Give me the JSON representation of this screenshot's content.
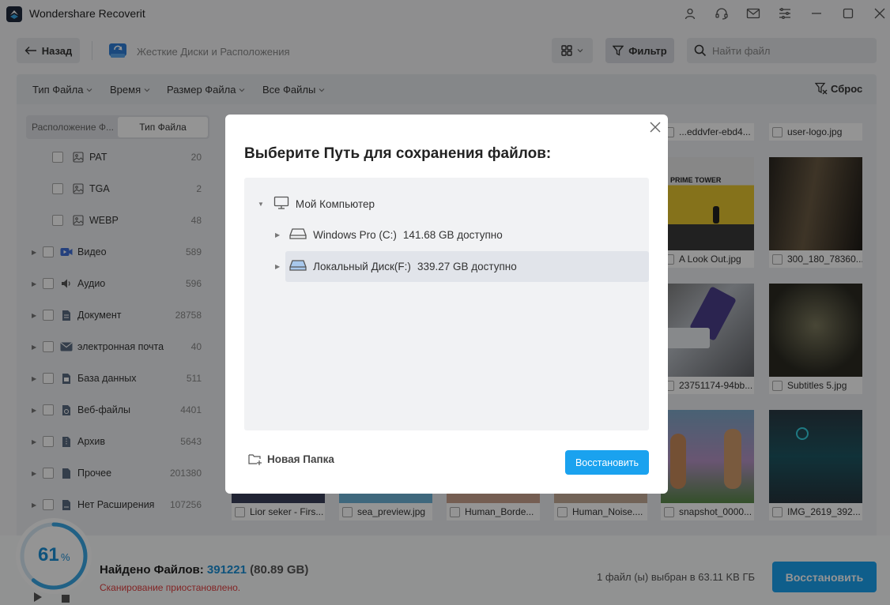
{
  "app": {
    "title": "Wondershare Recoverit"
  },
  "toolbar": {
    "back_label": "Назад",
    "location_label": "Жесткие Диски и Расположения",
    "filter_label": "Фильтр",
    "search_placeholder": "Найти файл"
  },
  "filters": {
    "file_type": "Тип Файла",
    "time": "Время",
    "file_size": "Размер Файла",
    "all_files": "Все Файлы",
    "reset": "Сброс"
  },
  "sidebar": {
    "tab_location": "Расположение Ф...",
    "tab_type": "Тип Файла",
    "sub_items": [
      {
        "label": "PAT",
        "count": "20"
      },
      {
        "label": "TGA",
        "count": "2"
      },
      {
        "label": "WEBP",
        "count": "48"
      }
    ],
    "items": [
      {
        "label": "Видео",
        "count": "589",
        "icon": "video-icon"
      },
      {
        "label": "Аудио",
        "count": "596",
        "icon": "audio-icon"
      },
      {
        "label": "Документ",
        "count": "28758",
        "icon": "document-icon"
      },
      {
        "label": "электронная почта",
        "count": "40",
        "icon": "email-icon"
      },
      {
        "label": "База данных",
        "count": "511",
        "icon": "database-icon"
      },
      {
        "label": "Веб-файлы",
        "count": "4401",
        "icon": "web-icon"
      },
      {
        "label": "Архив",
        "count": "5643",
        "icon": "archive-icon"
      },
      {
        "label": "Прочее",
        "count": "201380",
        "icon": "other-icon"
      },
      {
        "label": "Нет Расширения",
        "count": "107256",
        "icon": "no-extension-icon"
      }
    ]
  },
  "grid": {
    "top_captions": [
      "...eddvfer-ebd4...",
      "user-logo.jpg"
    ],
    "row1_captions": [
      "A Look Out.jpg",
      "300_180_78360..."
    ],
    "row2_captions": [
      "23751174-94bb...",
      "Subtitles 5.jpg"
    ],
    "row3_captions": [
      "Lior seker - Firs...",
      "sea_preview.jpg",
      "Human_Borde...",
      "Human_Noise....",
      "snapshot_0000...",
      "IMG_2619_392..."
    ],
    "prime_tower_text": "PRIME TOWER"
  },
  "modal": {
    "title": "Выберите Путь для сохранения файлов:",
    "root": "Мой Компьютер",
    "drives": [
      {
        "name": "Windows Pro (C:)",
        "free": "141.68 GB доступно"
      },
      {
        "name": "Локальный Диск(F:)",
        "free": "339.27 GB доступно"
      }
    ],
    "new_folder": "Новая Папка",
    "restore": "Восстановить"
  },
  "status": {
    "progress": "61",
    "progress_unit": "%",
    "found_label": "Найдено Файлов:",
    "found_count": "391221",
    "found_size": "(80.89 GB)",
    "paused": "Сканирование приостановлено.",
    "selected": "1 файл (ы) выбран в 63.11 KB ГБ",
    "restore": "Восстановить"
  },
  "colors": {
    "accent": "#1aa2ef",
    "progress": "#3aa7e6",
    "error": "#e04040"
  }
}
